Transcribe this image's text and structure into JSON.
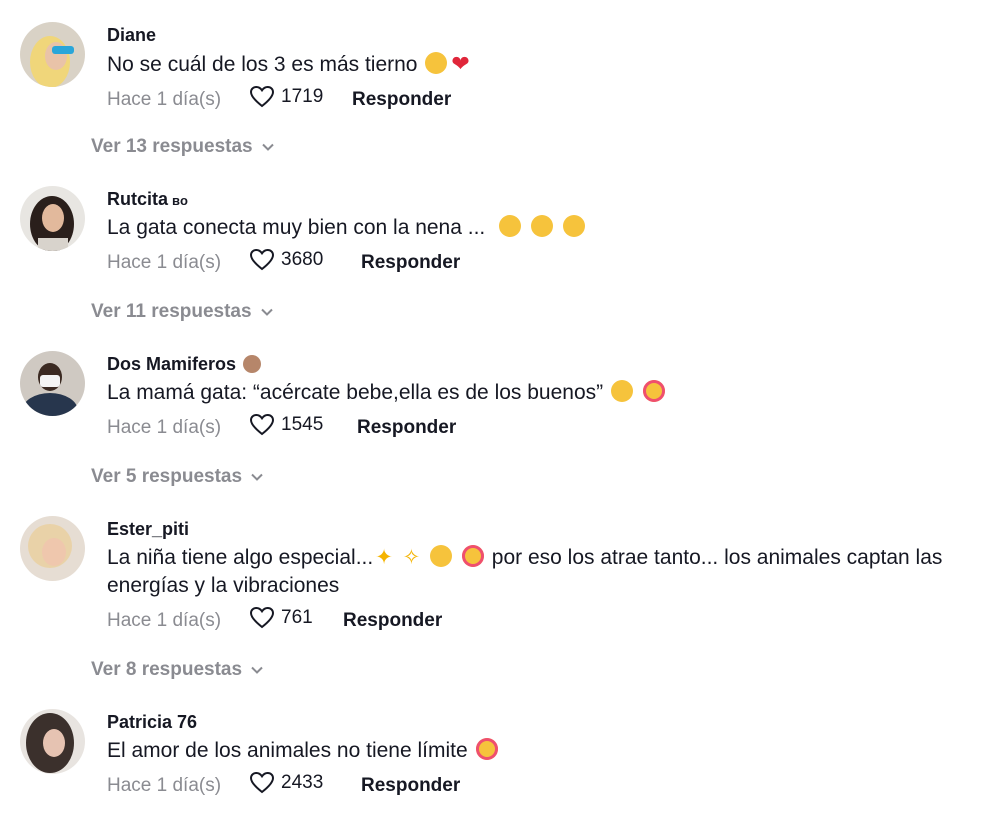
{
  "comments": [
    {
      "username": "Diane",
      "badge": "",
      "text": "No se cuál de los 3 es más tierno",
      "emojis": [
        "loudly-crying-face",
        "red-heart"
      ],
      "time": "Hace 1 día(s)",
      "likes": "1719",
      "reply_label": "Responder",
      "replies_label": "Ver 13 respuestas"
    },
    {
      "username": "Rutcita",
      "badge": "ʙᴏ",
      "text": "La gata conecta muy bien con la nena ...",
      "emojis": [
        "flushed-face",
        "flushed-face",
        "flushed-face"
      ],
      "time": "Hace 1 día(s)",
      "likes": "3680",
      "reply_label": "Responder",
      "replies_label": "Ver 11 respuestas"
    },
    {
      "username": "Dos Mamiferos",
      "badge": "",
      "text": "La mamá gata: “acércate bebe,ella es de los buenos”",
      "emojis": [
        "pleading-face",
        "smiling-face-with-hearts"
      ],
      "time": "Hace 1 día(s)",
      "likes": "1545",
      "reply_label": "Responder",
      "replies_label": "Ver 5 respuestas"
    },
    {
      "username": "Ester_piti",
      "badge": "",
      "text_part1": "La niña tiene algo especial...",
      "text_part2": "por eso los atrae tanto... los animales captan las energías y la vibraciones",
      "emojis": [
        "sparkles",
        "dizzy",
        "smiling-face-with-heart-eyes",
        "smiling-face-with-hearts"
      ],
      "time": "Hace 1 día(s)",
      "likes": "761",
      "reply_label": "Responder",
      "replies_label": "Ver 8 respuestas"
    },
    {
      "username": "Patricia 76",
      "badge": "",
      "text": "El amor de los animales no tiene límite",
      "emojis": [
        "smiling-face-with-hearts"
      ],
      "time": "Hace 1 día(s)",
      "likes": "2433",
      "reply_label": "Responder"
    }
  ],
  "colors": {
    "text": "#161823",
    "muted": "#8a8b91"
  }
}
